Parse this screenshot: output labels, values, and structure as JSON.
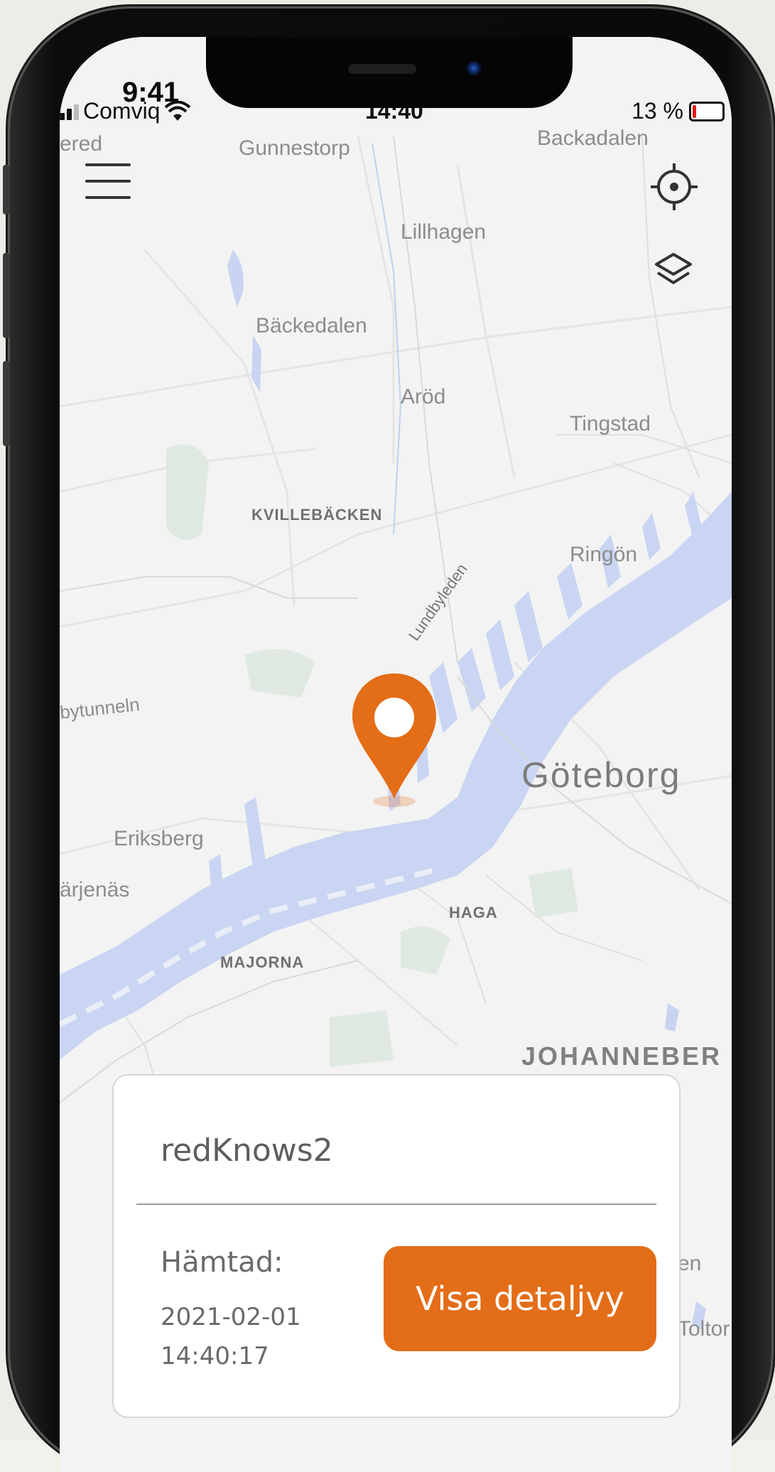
{
  "background_status": {
    "time": "9:41"
  },
  "statusbar": {
    "carrier": "Comviq",
    "time": "14:40",
    "battery_percent": "13 %",
    "battery_level": 0.13
  },
  "map": {
    "labels": {
      "ered": "ered",
      "gunnestorp": "Gunnestorp",
      "backadalen": "Backadalen",
      "lillhagen": "Lillhagen",
      "backedalen": "Bäckedalen",
      "arod": "Aröd",
      "tingstad": "Tingstad",
      "kvillebacken": "KVILLEBÄCKEN",
      "ringon": "Ringön",
      "lundbyleden": "Lundbyleden",
      "tunneln": "bytunneln",
      "goteborg": "Göteborg",
      "eriksberg": "Eriksberg",
      "farjenas": "ärjenäs",
      "haga": "HAGA",
      "majorna": "MAJORNA",
      "johanneberg": "JOHANNEBER",
      "en": "en",
      "toltor": "Toltor"
    },
    "icons": {
      "menu": "hamburger-menu-icon",
      "locate": "crosshair-locate-icon",
      "layers": "layers-icon",
      "pin": "map-pin-icon"
    },
    "colors": {
      "water": "#c9d5f2",
      "land": "#f2f2f2",
      "park": "#dde9e1",
      "pin": "#e46d17"
    }
  },
  "card": {
    "device_name": "redKnows2",
    "fetched_label": "Hämtad:",
    "fetched_date": "2021-02-01",
    "fetched_time": "14:40:17",
    "detail_button": "Visa detaljvy",
    "accent": "#e46d17"
  }
}
